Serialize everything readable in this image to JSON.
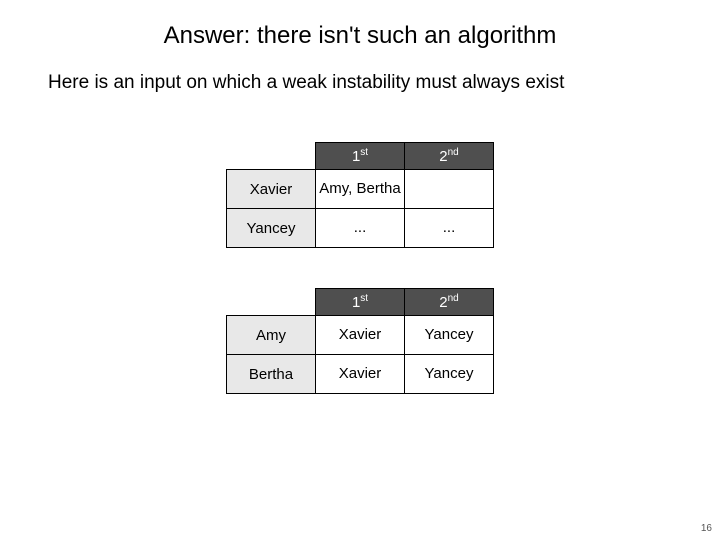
{
  "title": "Answer: there isn't such an algorithm",
  "subtitle": "Here is an input on which a weak instability must always exist",
  "col": {
    "first_num": "1",
    "first_suf": "st",
    "second_num": "2",
    "second_suf": "nd"
  },
  "men": {
    "rows": [
      {
        "name": "Xavier",
        "c1": "Amy, Bertha",
        "c2": ""
      },
      {
        "name": "Yancey",
        "c1": "...",
        "c2": "..."
      }
    ]
  },
  "women": {
    "rows": [
      {
        "name": "Amy",
        "c1": "Xavier",
        "c2": "Yancey"
      },
      {
        "name": "Bertha",
        "c1": "Xavier",
        "c2": "Yancey"
      }
    ]
  },
  "pageno": "16"
}
